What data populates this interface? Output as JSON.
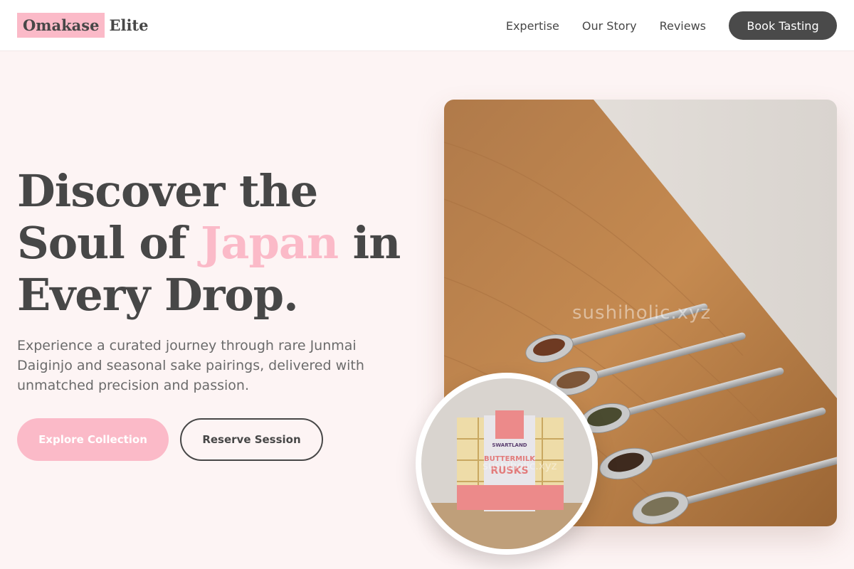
{
  "brand": {
    "highlight": "Omakase",
    "rest": "Elite"
  },
  "nav": {
    "links": [
      {
        "label": "Expertise"
      },
      {
        "label": "Our Story"
      },
      {
        "label": "Reviews"
      }
    ],
    "cta_label": "Book Tasting"
  },
  "hero": {
    "title_line1": "Discover the",
    "title_line2_prefix": "Soul of ",
    "title_accent": "Japan",
    "title_line2_suffix": " in",
    "title_line3": "Every Drop.",
    "subtitle": "Experience a curated journey through rare Junmai Daiginjo and seasonal sake pairings, delivered with unmatched precision and passion.",
    "primary_button": "Explore Collection",
    "secondary_button": "Reserve Session"
  },
  "image": {
    "watermark": "sushiholic.xyz"
  },
  "inset": {
    "package_brand": "SWARTLAND",
    "package_line1": "BUTTERMILK",
    "package_line2": "RUSKS",
    "watermark": "sushiholic.xyz"
  },
  "colors": {
    "accent": "#fbbac8",
    "text": "#474747",
    "cta_dark": "#4a4a4a",
    "page_bg": "#fdf4f4"
  }
}
